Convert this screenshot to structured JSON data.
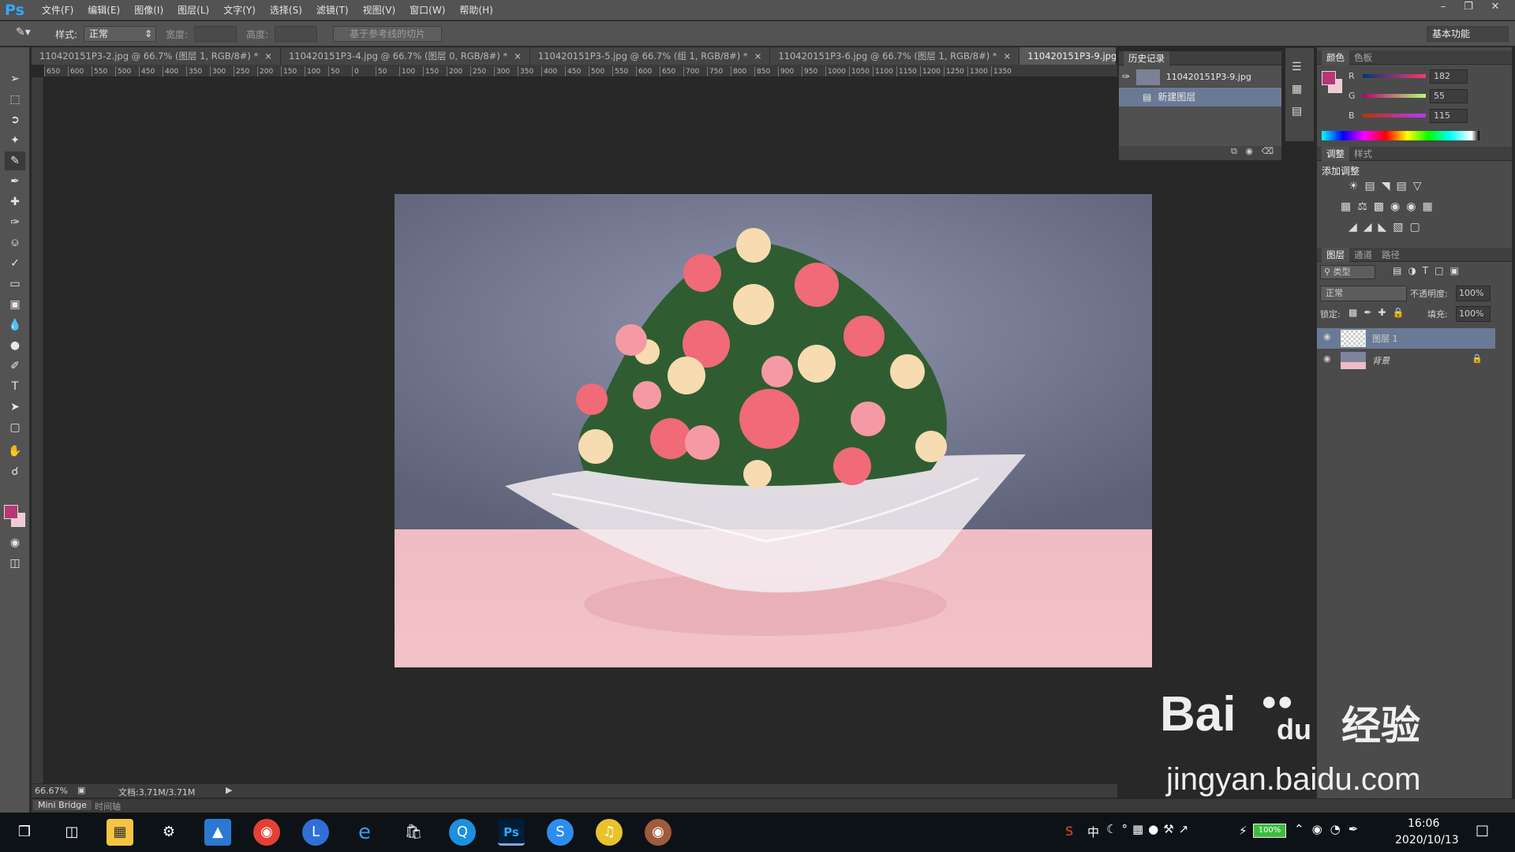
{
  "app": {
    "logo": "Ps"
  },
  "menu": [
    "文件(F)",
    "编辑(E)",
    "图像(I)",
    "图层(L)",
    "文字(Y)",
    "选择(S)",
    "滤镜(T)",
    "视图(V)",
    "窗口(W)",
    "帮助(H)"
  ],
  "options": {
    "style_label": "样式:",
    "style_value": "正常",
    "width_label": "宽度:",
    "height_label": "高度:",
    "slice_button": "基于参考线的切片",
    "workspace": "基本功能"
  },
  "tabs": [
    {
      "label": "110420151P3-2.jpg @ 66.7% (图层 1, RGB/8#) *",
      "close": "×"
    },
    {
      "label": "110420151P3-4.jpg @ 66.7% (图层 0, RGB/8#) *",
      "close": "×"
    },
    {
      "label": "110420151P3-5.jpg @ 66.7% (组 1, RGB/8#) *",
      "close": "×"
    },
    {
      "label": "110420151P3-6.jpg @ 66.7% (图层 1, RGB/8#) *",
      "close": "×"
    },
    {
      "label": "110420151P3-9.jpg @ 66.7% (图层 1, R",
      "close": ""
    }
  ],
  "ruler": [
    "650",
    "600",
    "550",
    "500",
    "450",
    "400",
    "350",
    "300",
    "250",
    "200",
    "150",
    "100",
    "50",
    "0",
    "50",
    "100",
    "150",
    "200",
    "250",
    "300",
    "350",
    "400",
    "450",
    "500",
    "550",
    "600",
    "650",
    "700",
    "750",
    "800",
    "850",
    "900",
    "950",
    "1000",
    "1050",
    "1100",
    "1150",
    "1200",
    "1250",
    "1300",
    "1350"
  ],
  "history": {
    "title": "历史记录",
    "snapshot": "110420151P3-9.jpg",
    "items": [
      "新建图层"
    ]
  },
  "color": {
    "tabs": [
      "颜色",
      "色板"
    ],
    "r_label": "R",
    "g_label": "G",
    "b_label": "B",
    "r": "182",
    "g": "55",
    "b": "115",
    "foreground": "#b63773",
    "background": "#f2c9d2"
  },
  "adjust": {
    "tabs": [
      "调整",
      "样式"
    ],
    "title": "添加调整"
  },
  "layers": {
    "tabs": [
      "图层",
      "通道",
      "路径"
    ],
    "filter": "类型",
    "blend": "正常",
    "opacity_label": "不透明度:",
    "opacity": "100%",
    "lock_label": "锁定:",
    "fill_label": "填充:",
    "fill": "100%",
    "items": [
      {
        "name": "图层 1"
      },
      {
        "name": "背景"
      }
    ]
  },
  "status": {
    "zoom": "66.67%",
    "doc": "文档:3.71M/3.71M"
  },
  "bottom_tabs": [
    "Mini Bridge",
    "时间轴"
  ],
  "taskbar": {
    "battery": "100%",
    "ime": "中",
    "time": "16:06",
    "date": "2020/10/13"
  },
  "watermark": {
    "brand": "Bai",
    "brand2": "du",
    "cn": "经验",
    "url": "jingyan.baidu.com"
  }
}
